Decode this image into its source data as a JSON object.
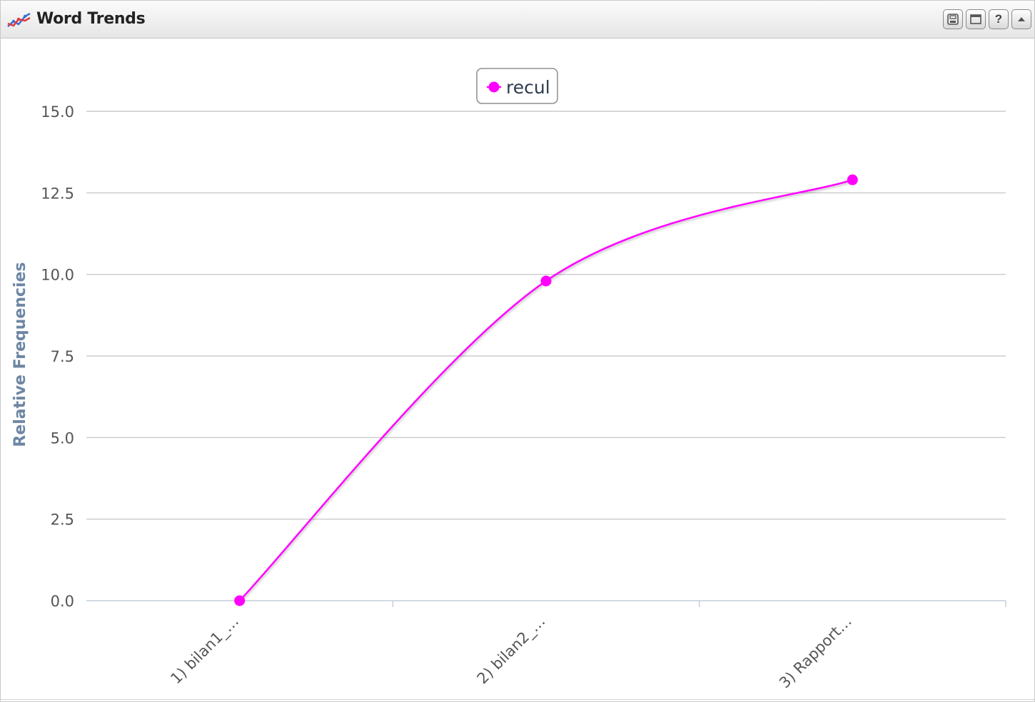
{
  "window": {
    "title": "Word Trends",
    "icon": "line-chart-icon",
    "tools": [
      {
        "name": "save-icon",
        "label": ""
      },
      {
        "name": "maximize-icon",
        "label": ""
      },
      {
        "name": "help-icon",
        "label": "?"
      },
      {
        "name": "collapse-icon",
        "label": ""
      }
    ]
  },
  "chart_data": {
    "type": "line",
    "categories": [
      "1) bilan1_…",
      "2) bilan2_…",
      "3) Rapport…"
    ],
    "series": [
      {
        "name": "recul",
        "values": [
          0.0,
          9.8,
          12.9
        ],
        "color": "#ff00ff"
      }
    ],
    "xlabel": "",
    "ylabel": "Relative Frequencies",
    "ylim": [
      0,
      15
    ],
    "yticks": [
      "0.0",
      "2.5",
      "5.0",
      "7.5",
      "10.0",
      "12.5",
      "15.0"
    ],
    "grid": true,
    "legend": "top-center",
    "smooth": true
  }
}
